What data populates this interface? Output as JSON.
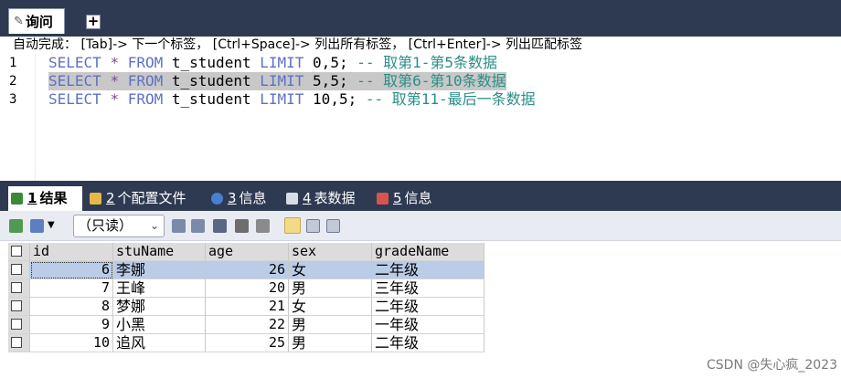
{
  "top_tabs": {
    "query_label": "询问",
    "add_tab_symbol": "+"
  },
  "hint": "自动完成： [Tab]-> 下一个标签， [Ctrl+Space]-> 列出所有标签， [Ctrl+Enter]-> 列出匹配标签",
  "editor": {
    "line_numbers": [
      "1",
      "2",
      "3"
    ],
    "lines": [
      {
        "kw1": "SELECT",
        "star": "*",
        "kw2": "FROM",
        "table": "t_student",
        "kw3": "LIMIT",
        "args": "0,5;",
        "comment": "-- 取第1-第5条数据"
      },
      {
        "kw1": "SELECT",
        "star": "*",
        "kw2": "FROM",
        "table": "t_student",
        "kw3": "LIMIT",
        "args": "5,5;",
        "comment": "-- 取第6-第10条数据"
      },
      {
        "kw1": "SELECT",
        "star": "*",
        "kw2": "FROM",
        "table": "t_student",
        "kw3": "LIMIT",
        "args": "10,5;",
        "comment": "-- 取第11-最后一条数据"
      }
    ]
  },
  "result_tabs": [
    {
      "num": "1",
      "label": "结果",
      "icon": "result-grid-icon"
    },
    {
      "num": "2",
      "label": "个配置文件",
      "icon": "profile-icon"
    },
    {
      "num": "3",
      "label": "信息",
      "icon": "info-icon"
    },
    {
      "num": "4",
      "label": "表数据",
      "icon": "table-data-icon"
    },
    {
      "num": "5",
      "label": "信息",
      "icon": "info-icon"
    }
  ],
  "toolbar": {
    "readonly_value": "（只读）"
  },
  "grid": {
    "columns": [
      "id",
      "stuName",
      "age",
      "sex",
      "gradeName"
    ],
    "rows": [
      [
        "6",
        "李娜",
        "26",
        "女",
        "二年级"
      ],
      [
        "7",
        "王峰",
        "20",
        "男",
        "三年级"
      ],
      [
        "8",
        "梦娜",
        "21",
        "女",
        "二年级"
      ],
      [
        "9",
        "小黑",
        "22",
        "男",
        "一年级"
      ],
      [
        "10",
        "追风",
        "25",
        "男",
        "二年级"
      ]
    ]
  },
  "watermark": "CSDN @失心疯_2023",
  "colors": {
    "chrome": "#2d3a51",
    "keyword": "#5c72c4",
    "comment": "#2a8f86",
    "selection": "#b9cce8"
  }
}
